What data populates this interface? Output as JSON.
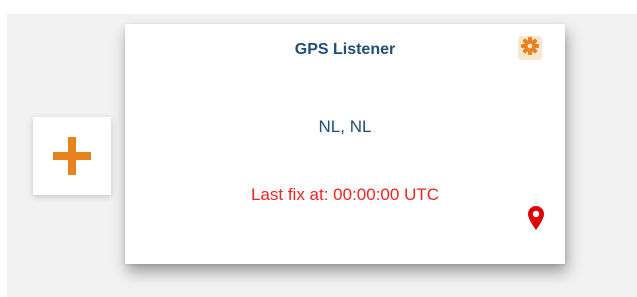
{
  "card": {
    "title": "GPS Listener",
    "location": "NL, NL",
    "status": "Last fix at: 00:00:00 UTC"
  },
  "icons": {
    "add": "plus-icon",
    "settings": "gear-icon",
    "location": "map-pin-icon"
  },
  "colors": {
    "accent": "#e8821e",
    "title_text": "#1f4e79",
    "status_text": "#ff1f1f",
    "pin": "#e00000",
    "background": "#f2f2f2"
  }
}
